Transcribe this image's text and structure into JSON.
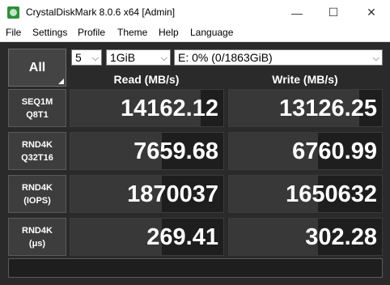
{
  "window": {
    "title": "CrystalDiskMark 8.0.6 x64 [Admin]",
    "minimize_glyph": "—",
    "maximize_glyph": "☐",
    "close_glyph": "✕"
  },
  "menu": [
    "File",
    "Settings",
    "Profile",
    "Theme",
    "Help",
    "Language"
  ],
  "controls": {
    "all_label": "All",
    "count": "5",
    "size": "1GiB",
    "drive": "E: 0% (0/1863GiB)",
    "dropdown_arrow": "⌵"
  },
  "headers": {
    "read": "Read (MB/s)",
    "write": "Write (MB/s)"
  },
  "tests": [
    {
      "line1": "SEQ1M",
      "line2": "Q8T1",
      "read": "14162.12",
      "write": "13126.25",
      "read_fill": 0.85,
      "write_fill": 0.85
    },
    {
      "line1": "RND4K",
      "line2": "Q32T16",
      "read": "7659.68",
      "write": "6760.99",
      "read_fill": 0.6,
      "write_fill": 0.58
    },
    {
      "line1": "RND4K",
      "line2": "(IOPS)",
      "read": "1870037",
      "write": "1650632",
      "read_fill": 0.6,
      "write_fill": 0.58
    },
    {
      "line1": "RND4K",
      "line2": "(μs)",
      "read": "269.41",
      "write": "302.28",
      "read_fill": 0.6,
      "write_fill": 0.58
    }
  ],
  "status": "",
  "colors": {
    "background": "#2b2b2b",
    "panel": "#1e1e1e",
    "text": "#ffffff",
    "bar_fill": "#383838"
  }
}
